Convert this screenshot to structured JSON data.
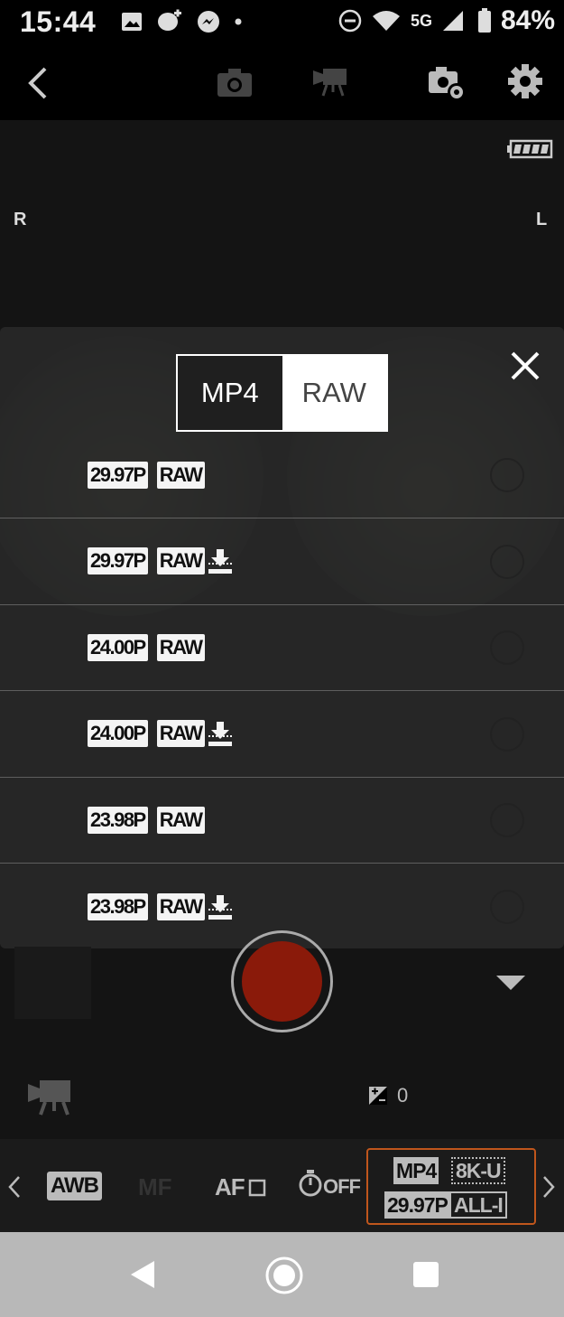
{
  "status_bar": {
    "time": "15:44",
    "network": "5G",
    "battery_percent": "84%"
  },
  "top_bar": {
    "back_icon": "chevron-left-icon",
    "photo_mode_icon": "camera-icon",
    "video_mode_icon": "video-camera-icon",
    "camera_settings_icon": "camera-gear-icon",
    "settings_icon": "gear-icon"
  },
  "preview": {
    "left_lens_label": "R",
    "right_lens_label": "L"
  },
  "overlay": {
    "tabs": [
      {
        "label": "MP4",
        "active": true
      },
      {
        "label": "RAW",
        "active": false
      }
    ],
    "options": [
      {
        "frame_rate": "29.97P",
        "format": "RAW",
        "download_icon": false,
        "selected": false
      },
      {
        "frame_rate": "29.97P",
        "format": "RAW",
        "download_icon": true,
        "selected": false
      },
      {
        "frame_rate": "24.00P",
        "format": "RAW",
        "download_icon": false,
        "selected": false
      },
      {
        "frame_rate": "24.00P",
        "format": "RAW",
        "download_icon": true,
        "selected": false
      },
      {
        "frame_rate": "23.98P",
        "format": "RAW",
        "download_icon": false,
        "selected": false
      },
      {
        "frame_rate": "23.98P",
        "format": "RAW",
        "download_icon": true,
        "selected": false
      }
    ]
  },
  "controls": {
    "record_color": "#8a1a0a",
    "exposure_comp_value": "0"
  },
  "settings_bar": {
    "white_balance": "AWB",
    "focus_mode_inactive": "MF",
    "af_mode": "AF",
    "self_timer": "OFF",
    "format": {
      "container": "MP4",
      "resolution": "8K-U",
      "frame_rate": "29.97P",
      "compression": "ALL-I"
    },
    "accent_color": "#c0561c"
  }
}
